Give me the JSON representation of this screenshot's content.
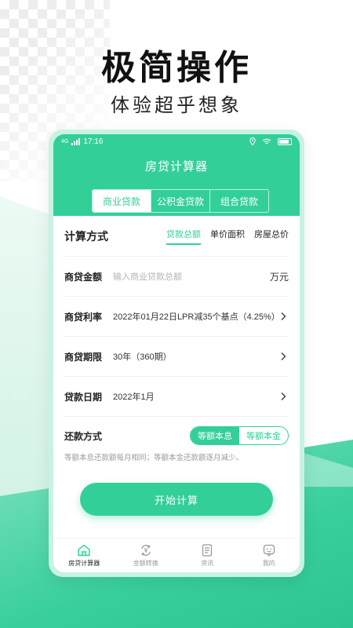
{
  "hero": {
    "headline": "极简操作",
    "subline": "体验超乎想象"
  },
  "status": {
    "network": "4G",
    "time": "17:16"
  },
  "app": {
    "title": "房贷计算器"
  },
  "loan_types": [
    {
      "label": "商业贷款",
      "active": true
    },
    {
      "label": "公积金贷款",
      "active": false
    },
    {
      "label": "组合贷款",
      "active": false
    }
  ],
  "calc": {
    "label": "计算方式",
    "modes": [
      {
        "label": "贷款总额",
        "active": true
      },
      {
        "label": "单价面积",
        "active": false
      },
      {
        "label": "房屋总价",
        "active": false
      }
    ]
  },
  "form": {
    "amount_label": "商贷金额",
    "amount_placeholder": "输入商业贷款总额",
    "amount_unit": "万元",
    "rate_label": "商贷利率",
    "rate_value": "2022年01月22日LPR减35个基点（4.25%）",
    "term_label": "商贷期限",
    "term_value": "30年（360期）",
    "date_label": "贷款日期",
    "date_value": "2022年1月",
    "repay_label": "还款方式",
    "repay_options": [
      "等额本息",
      "等额本金"
    ],
    "repay_note": "等额本息还款额每月相同；等额本金还款额逐月减少。"
  },
  "start_button": "开始计算",
  "tabs": [
    {
      "label": "房贷计算器",
      "icon": "home-icon",
      "active": true
    },
    {
      "label": "金额转换",
      "icon": "currency-convert-icon",
      "active": false
    },
    {
      "label": "资讯",
      "icon": "news-icon",
      "active": false
    },
    {
      "label": "我的",
      "icon": "profile-icon",
      "active": false
    }
  ],
  "colors": {
    "accent": "#33cf99"
  }
}
